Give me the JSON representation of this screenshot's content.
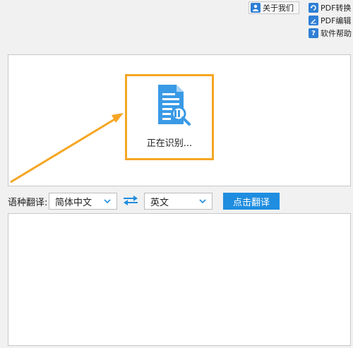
{
  "toolbar": {
    "about_label": "关于我们",
    "pdf_convert_label": "PDF转换",
    "pdf_edit_label": "PDF编辑",
    "help_label": "软件帮助"
  },
  "preview": {
    "status_text": "正在识别...",
    "highlight_color": "#f5a623"
  },
  "translate": {
    "lang_label": "语种翻译:",
    "source_lang": "简体中文",
    "target_lang": "英文",
    "button_label": "点击翻译"
  },
  "icons": [
    "person-icon",
    "refresh-icon",
    "edit-icon",
    "help-icon",
    "document-search-icon",
    "swap-arrows-icon",
    "chevron-down-icon"
  ]
}
